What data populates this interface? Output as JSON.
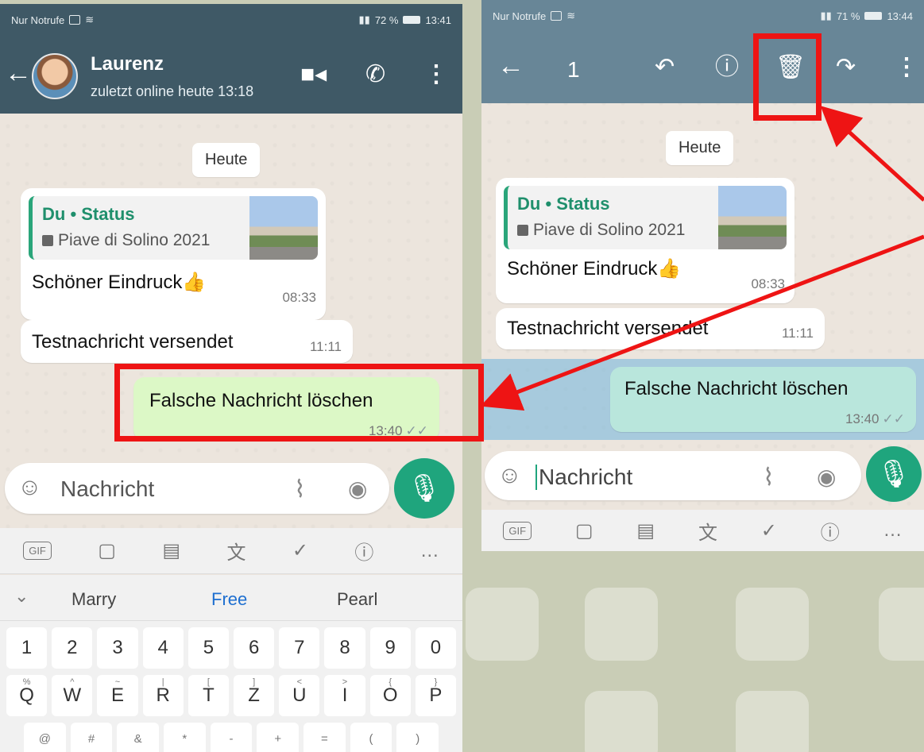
{
  "left": {
    "status": {
      "left": "Nur Notrufe",
      "right": "72 %",
      "time": "13:41"
    },
    "contact": {
      "name": "Laurenz",
      "status": "zuletzt online heute 13:18"
    },
    "date_chip": "Heute",
    "messages": [
      {
        "quote_title": "Du • Status",
        "quote_sub": "Piave di Solino 2021",
        "text": "Schöner Eindruck👍",
        "time": "08:33"
      },
      {
        "text": "Testnachricht versendet",
        "time": "11:11"
      },
      {
        "text": "Falsche Nachricht löschen",
        "time": "13:40"
      }
    ],
    "composer_placeholder": "Nachricht",
    "suggestions": [
      "Marry",
      "Free",
      "Pearl"
    ],
    "number_row": [
      "1",
      "2",
      "3",
      "4",
      "5",
      "6",
      "7",
      "8",
      "9",
      "0"
    ],
    "letter_row": [
      {
        "k": "Q",
        "s": "%"
      },
      {
        "k": "W",
        "s": "^"
      },
      {
        "k": "E",
        "s": "~"
      },
      {
        "k": "R",
        "s": "|"
      },
      {
        "k": "T",
        "s": "["
      },
      {
        "k": "Z",
        "s": "]"
      },
      {
        "k": "U",
        "s": "<"
      },
      {
        "k": "I",
        "s": ">"
      },
      {
        "k": "O",
        "s": "{"
      },
      {
        "k": "P",
        "s": "}"
      }
    ],
    "symbol_row": [
      "@",
      "#",
      "&",
      "*",
      "-",
      "+",
      "=",
      "(",
      ")"
    ]
  },
  "right": {
    "status": {
      "left": "Nur Notrufe",
      "right": "71 %",
      "time": "13:44"
    },
    "selection_count": "1",
    "date_chip": "Heute",
    "messages": [
      {
        "quote_title": "Du • Status",
        "quote_sub": "Piave di Solino 2021",
        "text": "Schöner Eindruck👍",
        "time": "08:33"
      },
      {
        "text": "Testnachricht versendet",
        "time": "11:11"
      },
      {
        "text": "Falsche Nachricht löschen",
        "time": "13:40"
      }
    ],
    "composer_placeholder": "Nachricht"
  },
  "icons": {
    "back": "arrow-left-icon",
    "video": "video-call-icon",
    "call": "phone-icon",
    "menu": "more-vert-icon",
    "reply": "reply-icon",
    "info": "info-icon",
    "delete": "trash-icon",
    "forward": "forward-icon",
    "emoji": "emoji-icon",
    "attach": "paperclip-icon",
    "camera": "camera-icon",
    "mic": "mic-icon"
  },
  "colors": {
    "header_left": "#3f5966",
    "header_right": "#688697",
    "whatsapp_green": "#1fa57d",
    "outgoing_bubble": "#dcf8c6",
    "annotation_red": "#ee1414",
    "selection_highlight": "#6fb5dc"
  }
}
